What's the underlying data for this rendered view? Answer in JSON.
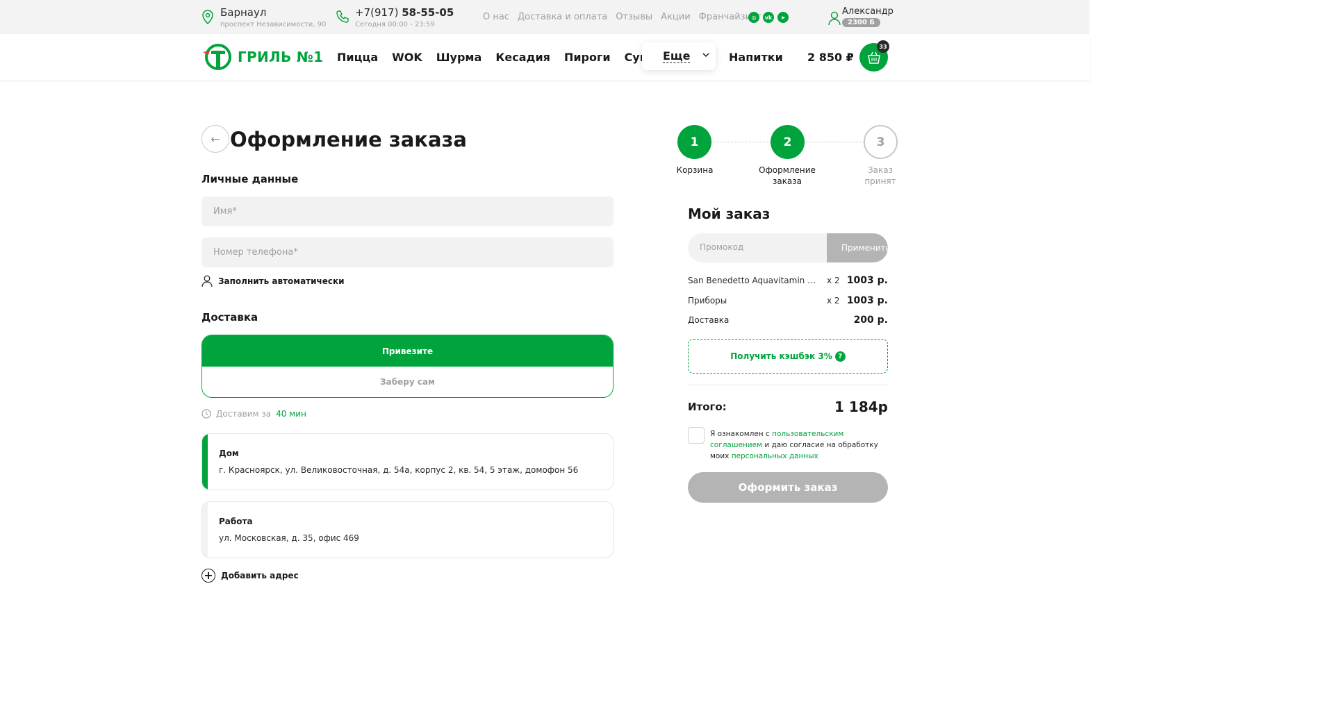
{
  "topbar": {
    "city": "Барнаул",
    "city_address": "проспект Независимости, 90",
    "phone_prefix": "+7(917)",
    "phone_main": "58-55-05",
    "hours": "Сегодня 00:00 - 23:59",
    "links": [
      "О нас",
      "Доставка и оплата",
      "Отзывы",
      "Акции",
      "Франчайзинг"
    ],
    "socials": [
      "instagram-icon",
      "vk-icon",
      "telegram-icon"
    ],
    "user_name": "Александр",
    "user_bonus": "2300 Б"
  },
  "header": {
    "logo_text": "ГРИЛЬ №1",
    "nav": [
      "Пицца",
      "WOK",
      "Шурма",
      "Кесадия",
      "Пироги",
      "Супы"
    ],
    "more_label": "Еще",
    "drinks_label": "Напитки",
    "cart_total": "2 850 ₽",
    "cart_count": "33"
  },
  "checkout": {
    "title": "Оформление заказа",
    "personal_title": "Личные данные",
    "name_placeholder": "Имя*",
    "phone_placeholder": "Номер телефона*",
    "autofill_label": "Заполнить автоматически",
    "delivery_title": "Доставка",
    "delivery_options": [
      "Привезите",
      "Заберу сам"
    ],
    "eta_prefix": "Доставим за",
    "eta_value": "40 мин",
    "addresses": [
      {
        "title": "Дом",
        "address": "г. Красноярск, ул. Великовосточная, д. 54а, корпус 2, кв. 54, 5 этаж, домофон 56"
      },
      {
        "title": "Работа",
        "address": "ул. Московская, д. 35, офис 469"
      }
    ],
    "add_address_label": "Добавить адрес"
  },
  "stepper": {
    "steps": [
      {
        "num": "1",
        "label": "Корзина"
      },
      {
        "num": "2",
        "label": "Оформление заказа"
      },
      {
        "num": "3",
        "label": "Заказ принят"
      }
    ],
    "current": 2
  },
  "order": {
    "title": "Мой заказ",
    "promo_placeholder": "Промокод",
    "promo_apply": "Применить",
    "items": [
      {
        "name": "San Benedetto Aquavitamin antiox",
        "qty": "x 2",
        "price": "1003 р."
      },
      {
        "name": "Приборы",
        "qty": "x 2",
        "price": "1003 р."
      },
      {
        "name": "Доставка",
        "qty": "",
        "price": "200 р."
      }
    ],
    "cashback_label": "Получить кэшбэк 3%",
    "total_label": "Итого:",
    "total_value": "1 184р",
    "agree_pre": "Я ознакомлен с ",
    "agree_link1": "пользовательским соглашением",
    "agree_mid": " и даю согласие на обработку моих ",
    "agree_link2": "персональных данных",
    "submit_label": "Оформить заказ"
  },
  "colors": {
    "accent": "#00a33c",
    "muted": "#a0a0a0",
    "disabled": "#b4b4b4",
    "field": "#f2f2f2"
  }
}
